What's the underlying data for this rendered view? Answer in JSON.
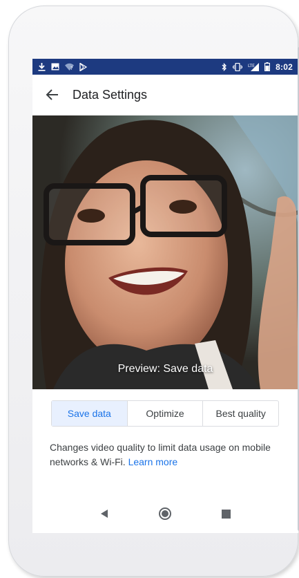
{
  "status_bar": {
    "time": "8:02",
    "left_icons": [
      "download-icon",
      "image-icon",
      "wifi-icon",
      "play-store-icon"
    ],
    "right_icons": [
      "bluetooth-icon",
      "vibrate-icon",
      "lte-signal-icon",
      "battery-icon"
    ],
    "network_label": "LTE",
    "background_color": "#1d3a80"
  },
  "app_bar": {
    "title": "Data Settings",
    "back_icon": "arrow-back-icon"
  },
  "preview": {
    "caption": "Preview: Save data"
  },
  "quality_options": {
    "selected": "Save data",
    "items": [
      {
        "label": "Save data"
      },
      {
        "label": "Optimize"
      },
      {
        "label": "Best quality"
      }
    ],
    "accent_color": "#1a73e8"
  },
  "description": {
    "text": "Changes video quality to limit data usage on mobile networks & Wi-Fi.",
    "link_text": "Learn more"
  },
  "nav_bar": {
    "icons": [
      "nav-back-icon",
      "nav-home-icon",
      "nav-recents-icon"
    ]
  }
}
